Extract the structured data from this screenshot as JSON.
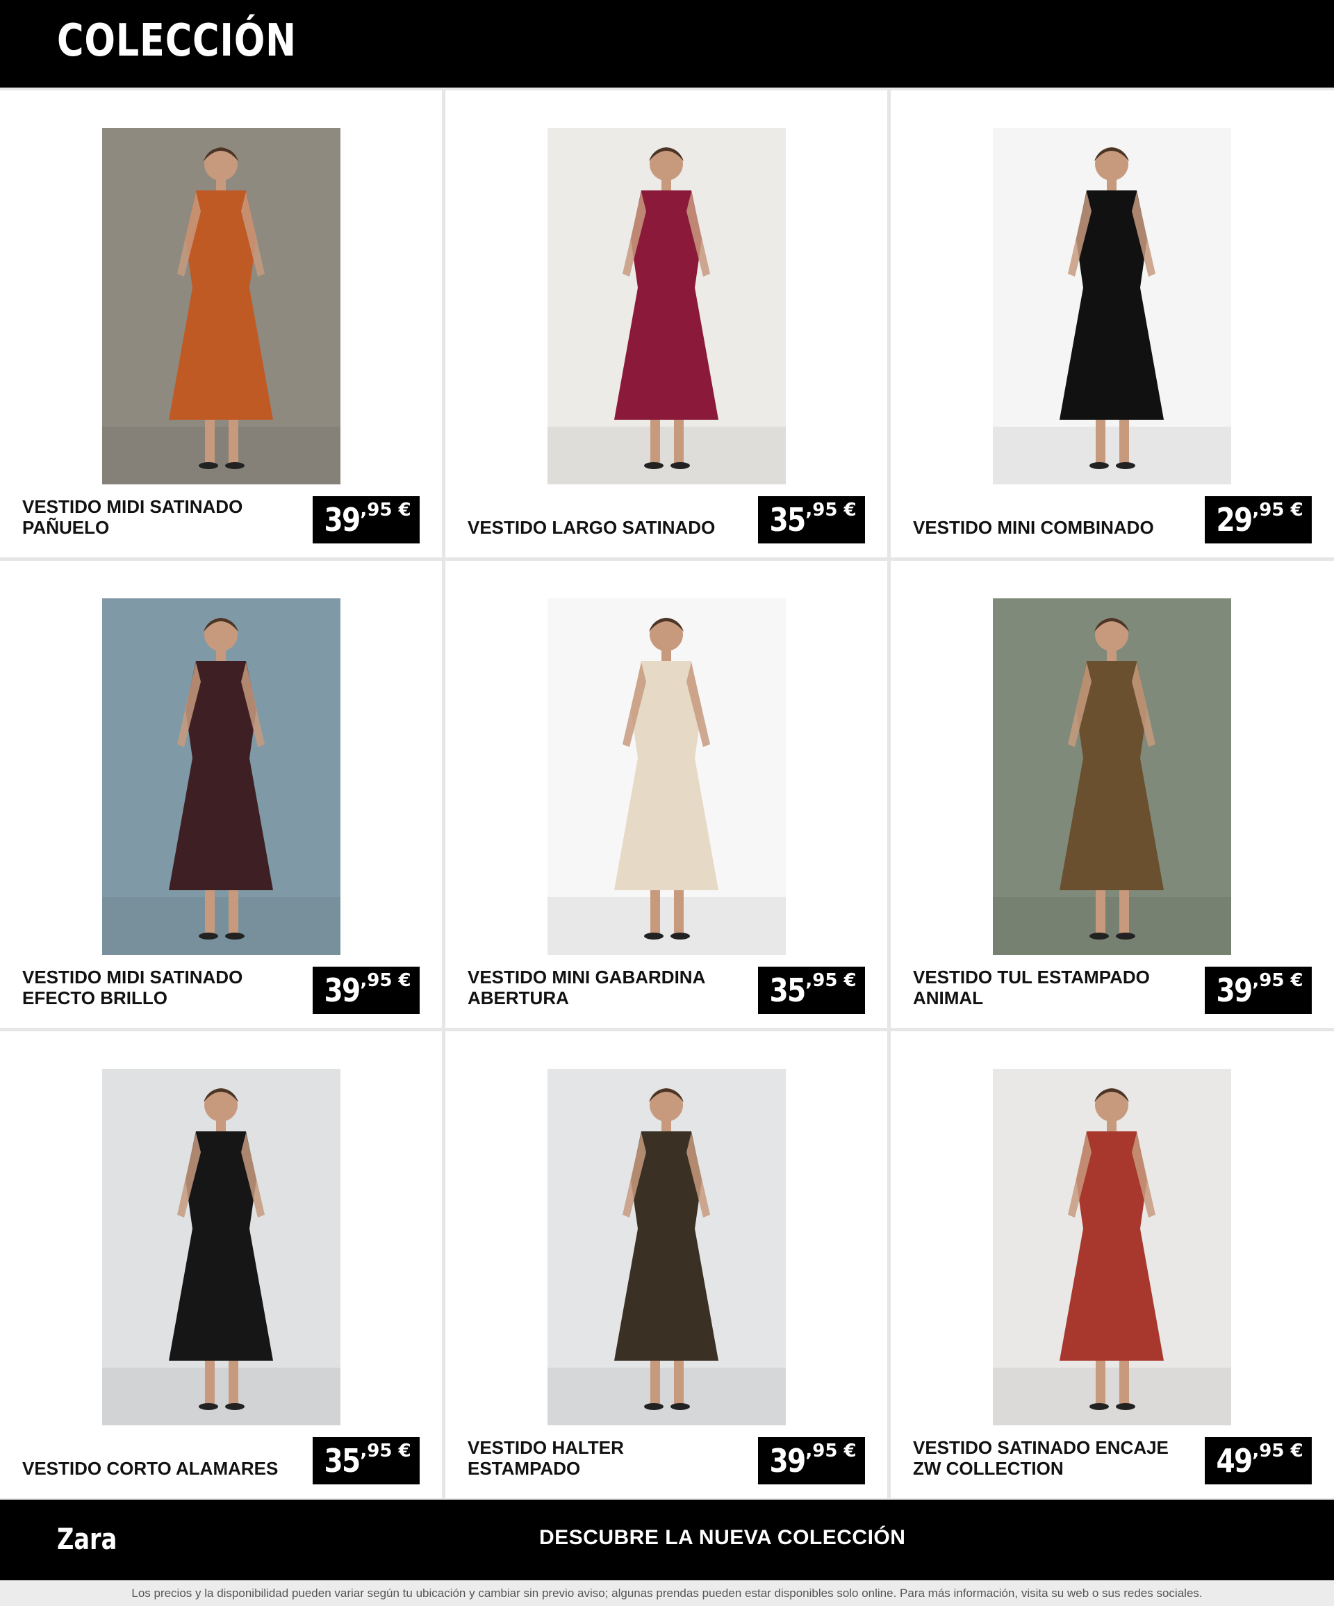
{
  "header": {
    "title": "COLECCIÓN"
  },
  "products": [
    {
      "name": "VESTIDO MIDI SATINADO PAÑUELO",
      "price_int": "39",
      "price_dec": ",95 €",
      "dress_color": "#c05a25",
      "bg_color": "#8e8a80"
    },
    {
      "name": "VESTIDO LARGO SATINADO",
      "price_int": "35",
      "price_dec": ",95 €",
      "dress_color": "#8b1a3a",
      "bg_color": "#ecebe8"
    },
    {
      "name": "VESTIDO MINI COMBINADO",
      "price_int": "29",
      "price_dec": ",95 €",
      "dress_color": "#111111",
      "bg_color": "#f5f5f5"
    },
    {
      "name": "VESTIDO MIDI SATINADO EFECTO BRILLO",
      "price_int": "39",
      "price_dec": ",95 €",
      "dress_color": "#3e1f24",
      "bg_color": "#7f9aa6"
    },
    {
      "name": "VESTIDO MINI GABARDINA ABERTURA",
      "price_int": "35",
      "price_dec": ",95 €",
      "dress_color": "#e6d9c6",
      "bg_color": "#f7f7f7"
    },
    {
      "name": "VESTIDO TUL ESTAMPADO ANIMAL",
      "price_int": "39",
      "price_dec": ",95 €",
      "dress_color": "#6b5030",
      "bg_color": "#7f8a7a"
    },
    {
      "name": "VESTIDO CORTO ALAMARES",
      "price_int": "35",
      "price_dec": ",95 €",
      "dress_color": "#161616",
      "bg_color": "#dfe1e3"
    },
    {
      "name": "VESTIDO HALTER ESTAMPADO",
      "price_int": "39",
      "price_dec": ",95 €",
      "dress_color": "#3a3024",
      "bg_color": "#e3e5e6"
    },
    {
      "name": "VESTIDO SATINADO ENCAJE ZW COLLECTION",
      "price_int": "49",
      "price_dec": ",95 €",
      "dress_color": "#a8382d",
      "bg_color": "#e9e8e6"
    }
  ],
  "footer": {
    "brand": "Zara",
    "cta": "DESCUBRE LA NUEVA COLECCIÓN",
    "disclaimer": "Los precios y la disponibilidad pueden variar según tu ubicación y cambiar sin previo aviso; algunas prendas pueden estar disponibles solo online. Para más información, visita su web o sus redes sociales."
  }
}
